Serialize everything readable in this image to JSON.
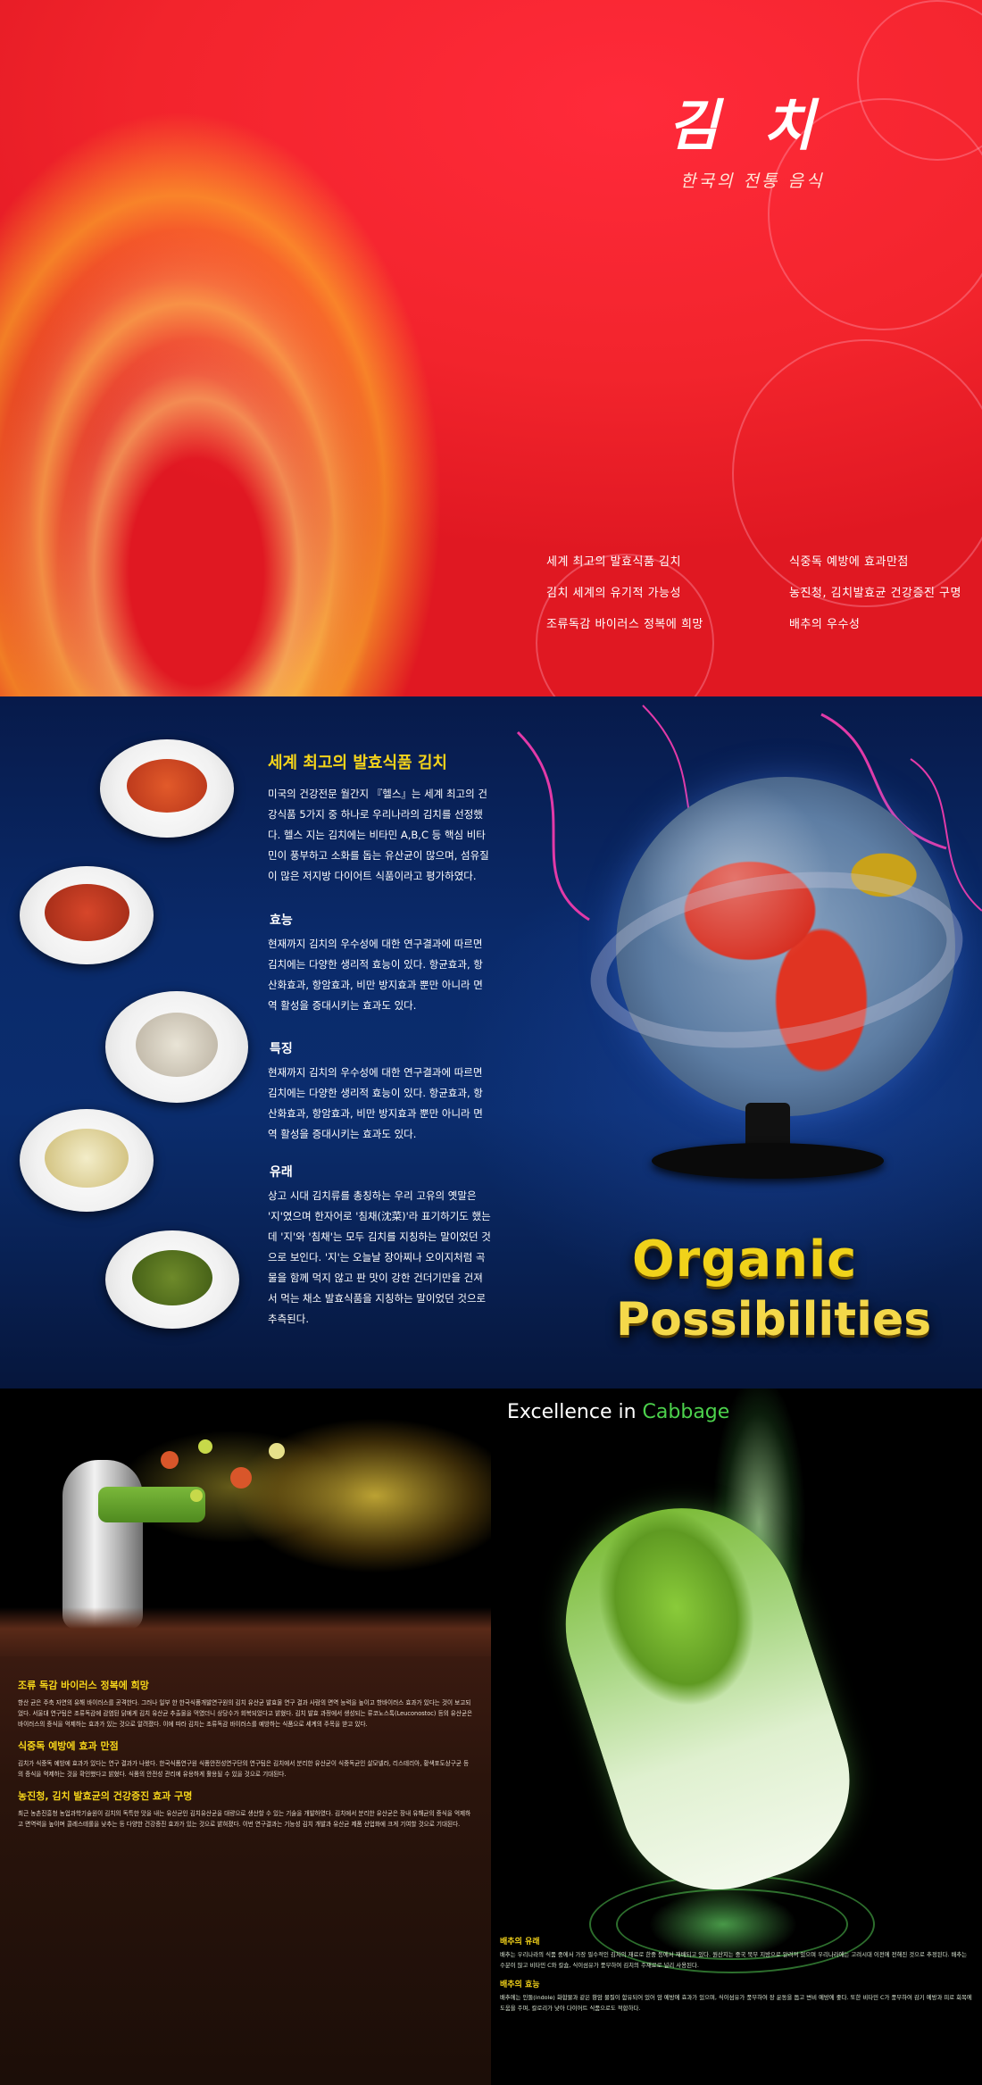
{
  "cover": {
    "title": "김 치",
    "subtitle": "한국의 전통 음식",
    "list_left": [
      "세계 최고의 발효식품 김치",
      "김치 세계의 유기적 가능성",
      "조류독감 바이러스 정복에 희망"
    ],
    "list_right": [
      "식중독 예방에 효과만점",
      "농진청, 김치발효균 건강증진 구명",
      "배추의 우수성"
    ]
  },
  "spread2": {
    "heading": "세계 최고의 발효식품 김치",
    "intro": "미국의 건강전문 월간지 『헬스』는 세계 최고의 건강식품 5가지 중 하나로 우리나라의 김치를 선정했다. 헬스 지는 김치에는 비타민 A,B,C 등 핵심 비타민이 풍부하고 소화를 돕는 유산균이 많으며, 섬유질이 많은 저지방 다이어트 식품이라고 평가하였다.",
    "sections": [
      {
        "title": "효능",
        "text": "현재까지 김치의 우수성에 대한 연구결과에 따르면 김치에는 다양한 생리적 효능이 있다. 항균효과, 항산화효과, 항암효과, 비만 방지효과 뿐만 아니라 면역 활성을 증대시키는 효과도 있다."
      },
      {
        "title": "특징",
        "text": "현재까지 김치의 우수성에 대한 연구결과에 따르면 김치에는 다양한 생리적 효능이 있다. 항균효과, 항산화효과, 항암효과, 비만 방지효과 뿐만 아니라 면역 활성을 증대시키는 효과도 있다."
      },
      {
        "title": "유래",
        "text": "상고 시대 김치류를 총칭하는 우리 고유의 옛말은 '지'였으며 한자어로 '침채(沈菜)'라 표기하기도 했는데 '지'와 '침채'는 모두 김치를 지칭하는 말이었던 것으로 보인다. '지'는 오늘날 장아찌나 오이지처럼 곡물을 함께 먹지 않고 판 맛이 강한 건더기만을 건져서 먹는 채소 발효식품을 지칭하는 말이었던 것으로 추측된다."
      }
    ],
    "organic_line1": "Organic",
    "organic_line2": "Possibilities"
  },
  "spread3": {
    "left_sections": [
      {
        "title": "조류 독감 바이러스 정복에 희망",
        "text": "항산 균은 주축 자연의 유해 바이러스를 공격한다. 그러나 일부 한 한국식품개발연구원의 김치 유산균 발효물 연구 결과 사람의 면역 능력을 높이고 항바이러스 효과가 있다는 것이 보고되었다. 서울대 연구팀은 조류독감에 감염된 닭에게 김치 유산균 추출물을 먹였더니 상당수가 회복되었다고 밝혔다. 김치 발효 과정에서 생성되는 류코노스톡(Leuconostoc) 등의 유산균은 바이러스의 증식을 억제하는 효과가 있는 것으로 알려졌다. 이에 따라 김치는 조류독감 바이러스를 예방하는 식품으로 세계의 주목을 받고 있다."
      },
      {
        "title": "식중독 예방에 효과 만점",
        "text": "김치가 식중독 예방에 효과가 있다는 연구 결과가 나왔다. 한국식품연구원 식품안전성연구단의 연구팀은 김치에서 분리한 유산균이 식중독균인 살모넬라, 리스테리아, 황색포도상구균 등의 증식을 억제하는 것을 확인했다고 밝혔다. 식품의 안전성 관리에 유용하게 활용될 수 있을 것으로 기대된다."
      },
      {
        "title": "농진청, 김치 발효균의 건강증진 효과 구명",
        "text": "최근 농촌진흥청 농업과학기술원이 김치의 독특한 맛을 내는 유산균인 김치유산균을 대량으로 생산할 수 있는 기술을 개발하였다. 김치에서 분리한 유산균은 장내 유해균의 증식을 억제하고 면역력을 높이며 콜레스테롤을 낮추는 등 다양한 건강증진 효과가 있는 것으로 밝혀졌다. 이번 연구결과는 기능성 김치 개발과 유산균 제품 산업화에 크게 기여할 것으로 기대된다."
      }
    ],
    "right_title_white": "Excellence in ",
    "right_title_green": "Cabbage",
    "right_sections": [
      {
        "title": "배추의 유래",
        "text": "배추는 우리나라의 식품 중에서 가장 필수적인 김치의 재료로 한중 등에서 재배되고 있다. 원산지는 중국 북부 지방으로 알려져 있으며 우리나라에는 고려시대 이전에 전해진 것으로 추정된다. 배추는 수분이 많고 비타민 C와 칼슘, 식이섬유가 풍부하여 김치의 주재료로 널리 사용된다."
      },
      {
        "title": "배추의 효능",
        "text": "배추에는 인돌(indole) 화합물과 같은 항암 물질이 함유되어 있어 암 예방에 효과가 있으며, 식이섬유가 풍부하여 장 운동을 돕고 변비 예방에 좋다. 또한 비타민 C가 풍부하여 감기 예방과 피로 회복에 도움을 주며, 칼로리가 낮아 다이어트 식품으로도 적합하다."
      }
    ]
  }
}
